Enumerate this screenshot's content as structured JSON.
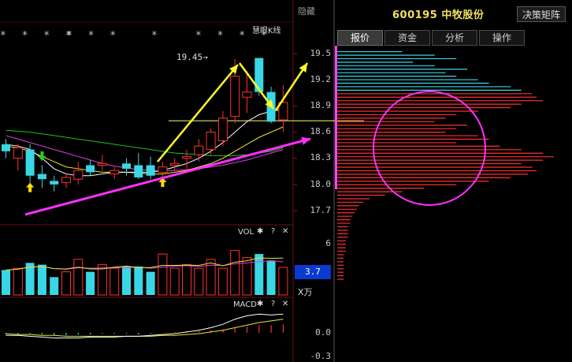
{
  "header": {
    "hide_label": "隐藏",
    "stock_code": "600195",
    "stock_name": "中牧股份",
    "matrix_button": "决策矩阵"
  },
  "tabs": [
    {
      "label": "报价",
      "active": true
    },
    {
      "label": "资金",
      "active": false
    },
    {
      "label": "分析",
      "active": false
    },
    {
      "label": "操作",
      "active": false
    }
  ],
  "main_chart": {
    "indicator_name": "慧眼K线",
    "star_groups": [
      "* * * *",
      "* * *",
      "*",
      "* * * *"
    ],
    "high_marker": "19.45→",
    "price_axis": [
      "19.5",
      "19.2",
      "18.9",
      "18.6",
      "18.3",
      "18.0",
      "17.7"
    ],
    "reference_price": 18.73
  },
  "volume_panel": {
    "title": "VOL",
    "axis": [
      "6"
    ],
    "current_value": "3.7",
    "unit": "X万"
  },
  "macd_panel": {
    "title": "MACD",
    "axis": [
      "0.0",
      "-0.3"
    ]
  },
  "controls": {
    "gear": "✱",
    "help": "?",
    "close": "✕"
  },
  "colors": {
    "up": "#ff3030",
    "down": "#3ad6e6",
    "annot_yellow": "#ffff20",
    "annot_magenta": "#ff30ff",
    "ma_white": "#ffffff",
    "ma_yellow": "#e8e830",
    "ma_magenta": "#e040e0",
    "ma_green": "#20c020"
  },
  "chart_data": {
    "type": "candlestick",
    "price_ylim": [
      17.7,
      19.5
    ],
    "candles": [
      {
        "o": 18.46,
        "h": 18.52,
        "l": 18.3,
        "c": 18.38
      },
      {
        "o": 18.3,
        "h": 18.46,
        "l": 18.16,
        "c": 18.42
      },
      {
        "o": 18.4,
        "h": 18.46,
        "l": 18.02,
        "c": 18.1
      },
      {
        "o": 18.12,
        "h": 18.22,
        "l": 17.96,
        "c": 18.06
      },
      {
        "o": 18.04,
        "h": 18.1,
        "l": 17.92,
        "c": 18.0
      },
      {
        "o": 18.02,
        "h": 18.12,
        "l": 17.96,
        "c": 18.08
      },
      {
        "o": 18.06,
        "h": 18.26,
        "l": 18.0,
        "c": 18.16
      },
      {
        "o": 18.22,
        "h": 18.28,
        "l": 18.1,
        "c": 18.14
      },
      {
        "o": 18.22,
        "h": 18.34,
        "l": 18.16,
        "c": 18.24
      },
      {
        "o": 18.12,
        "h": 18.2,
        "l": 18.06,
        "c": 18.16
      },
      {
        "o": 18.24,
        "h": 18.3,
        "l": 18.1,
        "c": 18.18
      },
      {
        "o": 18.22,
        "h": 18.36,
        "l": 18.06,
        "c": 18.08
      },
      {
        "o": 18.22,
        "h": 18.32,
        "l": 18.06,
        "c": 18.1
      },
      {
        "o": 18.14,
        "h": 18.26,
        "l": 18.08,
        "c": 18.2
      },
      {
        "o": 18.22,
        "h": 18.3,
        "l": 18.16,
        "c": 18.24
      },
      {
        "o": 18.3,
        "h": 18.4,
        "l": 18.18,
        "c": 18.32
      },
      {
        "o": 18.34,
        "h": 18.52,
        "l": 18.26,
        "c": 18.44
      },
      {
        "o": 18.4,
        "h": 18.64,
        "l": 18.34,
        "c": 18.6
      },
      {
        "o": 18.5,
        "h": 18.84,
        "l": 18.44,
        "c": 18.76
      },
      {
        "o": 18.78,
        "h": 19.44,
        "l": 18.7,
        "c": 19.24
      },
      {
        "o": 19.0,
        "h": 19.3,
        "l": 18.82,
        "c": 19.06
      },
      {
        "o": 19.45,
        "h": 19.45,
        "l": 19.02,
        "c": 19.06
      },
      {
        "o": 19.06,
        "h": 19.12,
        "l": 18.7,
        "c": 18.72
      },
      {
        "o": 18.74,
        "h": 19.14,
        "l": 18.6,
        "c": 18.94
      }
    ],
    "ma_white": [
      18.46,
      18.44,
      18.4,
      18.3,
      18.18,
      18.12,
      18.1,
      18.1,
      18.12,
      18.14,
      18.14,
      18.14,
      18.14,
      18.16,
      18.2,
      18.24,
      18.3,
      18.38,
      18.48,
      18.6,
      18.72,
      18.8,
      18.84,
      18.86
    ],
    "ma_yellow": [
      18.44,
      18.42,
      18.38,
      18.32,
      18.26,
      18.2,
      18.18,
      18.16,
      18.14,
      18.14,
      18.14,
      18.13,
      18.12,
      18.12,
      18.14,
      18.16,
      18.2,
      18.24,
      18.3,
      18.38,
      18.46,
      18.54,
      18.6,
      18.66
    ],
    "ma_magenta": [
      18.56,
      18.52,
      18.48,
      18.44,
      18.4,
      18.36,
      18.32,
      18.28,
      18.24,
      18.21,
      18.19,
      18.17,
      18.16,
      18.15,
      18.16,
      18.17,
      18.18,
      18.2,
      18.22,
      18.25,
      18.28,
      18.32,
      18.36,
      18.4
    ],
    "ma_green": [
      18.62,
      18.61,
      18.6,
      18.58,
      18.56,
      18.54,
      18.52,
      18.5,
      18.48,
      18.46,
      18.44,
      18.42,
      18.4,
      18.38,
      18.36,
      18.35,
      18.34,
      18.33,
      18.33,
      18.33,
      18.34,
      18.36,
      18.38,
      18.42
    ],
    "volume": [
      2.8,
      3.0,
      3.6,
      3.4,
      2.0,
      2.6,
      4.0,
      2.6,
      3.4,
      3.0,
      3.2,
      3.2,
      2.6,
      4.6,
      3.0,
      3.4,
      3.0,
      4.0,
      3.0,
      5.0,
      4.2,
      4.6,
      3.8,
      3.1
    ],
    "vol_ylim": [
      0,
      8
    ],
    "macd_hist": [
      -0.02,
      -0.02,
      -0.01,
      -0.02,
      -0.03,
      -0.03,
      -0.02,
      -0.02,
      -0.01,
      -0.01,
      -0.01,
      -0.02,
      -0.01,
      0.0,
      0.01,
      0.01,
      0.02,
      0.03,
      0.04,
      0.06,
      0.07,
      0.09,
      0.09,
      0.1
    ],
    "macd_dif": [
      -0.03,
      -0.03,
      -0.04,
      -0.05,
      -0.06,
      -0.06,
      -0.06,
      -0.05,
      -0.05,
      -0.05,
      -0.04,
      -0.04,
      -0.03,
      -0.02,
      -0.01,
      0.01,
      0.03,
      0.06,
      0.1,
      0.16,
      0.2,
      0.22,
      0.21,
      0.22
    ],
    "macd_dea": [
      -0.01,
      -0.02,
      -0.02,
      -0.03,
      -0.03,
      -0.04,
      -0.04,
      -0.04,
      -0.04,
      -0.04,
      -0.04,
      -0.04,
      -0.04,
      -0.03,
      -0.03,
      -0.02,
      -0.01,
      0.01,
      0.03,
      0.06,
      0.09,
      0.12,
      0.14,
      0.16
    ],
    "macd_ylim": [
      -0.3,
      0.35
    ],
    "profile_ylim": [
      17.7,
      19.55
    ],
    "profile": [
      [
        19.5,
        0.3
      ],
      [
        19.46,
        0.45
      ],
      [
        19.42,
        0.55
      ],
      [
        19.38,
        0.35
      ],
      [
        19.34,
        0.45
      ],
      [
        19.3,
        0.6
      ],
      [
        19.26,
        0.5
      ],
      [
        19.22,
        0.55
      ],
      [
        19.18,
        0.65
      ],
      [
        19.14,
        0.7
      ],
      [
        19.1,
        0.8
      ],
      [
        19.06,
        0.85
      ],
      [
        19.02,
        0.9
      ],
      [
        18.98,
        0.92
      ],
      [
        18.94,
        0.95
      ],
      [
        18.9,
        0.85
      ],
      [
        18.86,
        0.8
      ],
      [
        18.82,
        0.65
      ],
      [
        18.78,
        0.55
      ],
      [
        18.74,
        0.5
      ],
      [
        18.7,
        0.45
      ],
      [
        18.66,
        0.6
      ],
      [
        18.62,
        0.55
      ],
      [
        18.58,
        0.5
      ],
      [
        18.54,
        0.65
      ],
      [
        18.5,
        0.7
      ],
      [
        18.46,
        0.55
      ],
      [
        18.42,
        0.75
      ],
      [
        18.38,
        0.85
      ],
      [
        18.34,
        0.95
      ],
      [
        18.3,
        1.0
      ],
      [
        18.26,
        0.95
      ],
      [
        18.22,
        0.85
      ],
      [
        18.18,
        0.9
      ],
      [
        18.14,
        0.92
      ],
      [
        18.1,
        0.88
      ],
      [
        18.06,
        0.8
      ],
      [
        18.02,
        0.7
      ],
      [
        17.98,
        0.55
      ],
      [
        17.94,
        0.4
      ],
      [
        17.9,
        0.3
      ],
      [
        17.86,
        0.22
      ],
      [
        17.82,
        0.15
      ],
      [
        17.78,
        0.12
      ],
      [
        17.74,
        0.1
      ],
      [
        17.7,
        0.09
      ],
      [
        17.66,
        0.08
      ],
      [
        17.62,
        0.07
      ],
      [
        17.58,
        0.06
      ],
      [
        17.54,
        0.06
      ],
      [
        17.5,
        0.05
      ],
      [
        17.46,
        0.05
      ],
      [
        17.42,
        0.05
      ],
      [
        17.38,
        0.05
      ],
      [
        17.34,
        0.04
      ],
      [
        17.3,
        0.04
      ],
      [
        17.26,
        0.04
      ],
      [
        17.22,
        0.04
      ],
      [
        17.18,
        0.03
      ],
      [
        17.14,
        0.03
      ],
      [
        17.1,
        0.03
      ],
      [
        17.06,
        0.03
      ],
      [
        17.02,
        0.03
      ],
      [
        16.98,
        0.03
      ],
      [
        16.94,
        0.03
      ],
      [
        16.9,
        0.03
      ]
    ],
    "profile_cyan_above": 19.05,
    "profile_max_width": 275
  }
}
